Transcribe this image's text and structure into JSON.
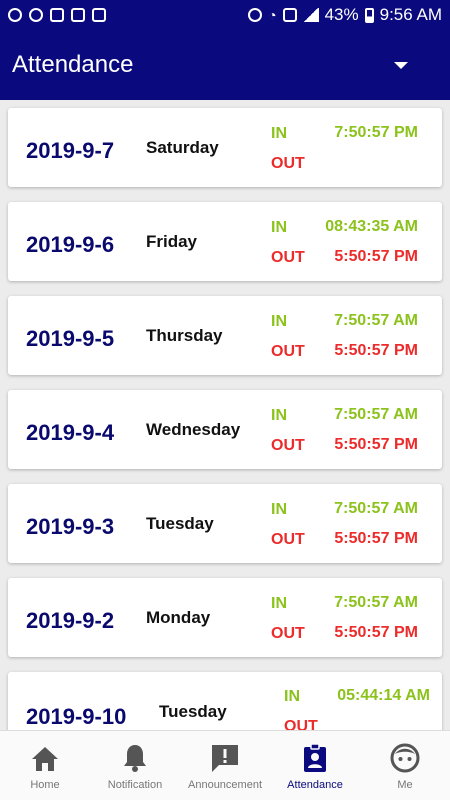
{
  "status_bar": {
    "battery": "43%",
    "time": "9:56 AM"
  },
  "app_bar": {
    "title": "Attendance"
  },
  "records": [
    {
      "date": "2019-9-7",
      "day": "Saturday",
      "in_label": "IN",
      "in_time": "7:50:57 PM",
      "out_label": "OUT",
      "out_time": ""
    },
    {
      "date": "2019-9-6",
      "day": "Friday",
      "in_label": "IN",
      "in_time": "08:43:35 AM",
      "out_label": "OUT",
      "out_time": "5:50:57 PM"
    },
    {
      "date": "2019-9-5",
      "day": "Thursday",
      "in_label": "IN",
      "in_time": "7:50:57 AM",
      "out_label": "OUT",
      "out_time": "5:50:57 PM"
    },
    {
      "date": "2019-9-4",
      "day": "Wednesday",
      "in_label": "IN",
      "in_time": "7:50:57 AM",
      "out_label": "OUT",
      "out_time": "5:50:57 PM"
    },
    {
      "date": "2019-9-3",
      "day": "Tuesday",
      "in_label": "IN",
      "in_time": "7:50:57 AM",
      "out_label": "OUT",
      "out_time": "5:50:57 PM"
    },
    {
      "date": "2019-9-2",
      "day": "Monday",
      "in_label": "IN",
      "in_time": "7:50:57 AM",
      "out_label": "OUT",
      "out_time": "5:50:57 PM"
    },
    {
      "date": "2019-9-10",
      "day": "Tuesday",
      "in_label": "IN",
      "in_time": "05:44:14 AM",
      "out_label": "OUT",
      "out_time": ""
    }
  ],
  "bottom_nav": [
    {
      "label": "Home",
      "icon": "home-icon",
      "active": false
    },
    {
      "label": "Notification",
      "icon": "bell-icon",
      "active": false
    },
    {
      "label": "Announcement",
      "icon": "announcement-icon",
      "active": false
    },
    {
      "label": "Attendance",
      "icon": "badge-icon",
      "active": true
    },
    {
      "label": "Me",
      "icon": "face-icon",
      "active": false
    }
  ],
  "colors": {
    "primary": "#0a0a7e",
    "in": "#8cc21c",
    "out": "#ec2b2b",
    "inactive": "#777777"
  }
}
